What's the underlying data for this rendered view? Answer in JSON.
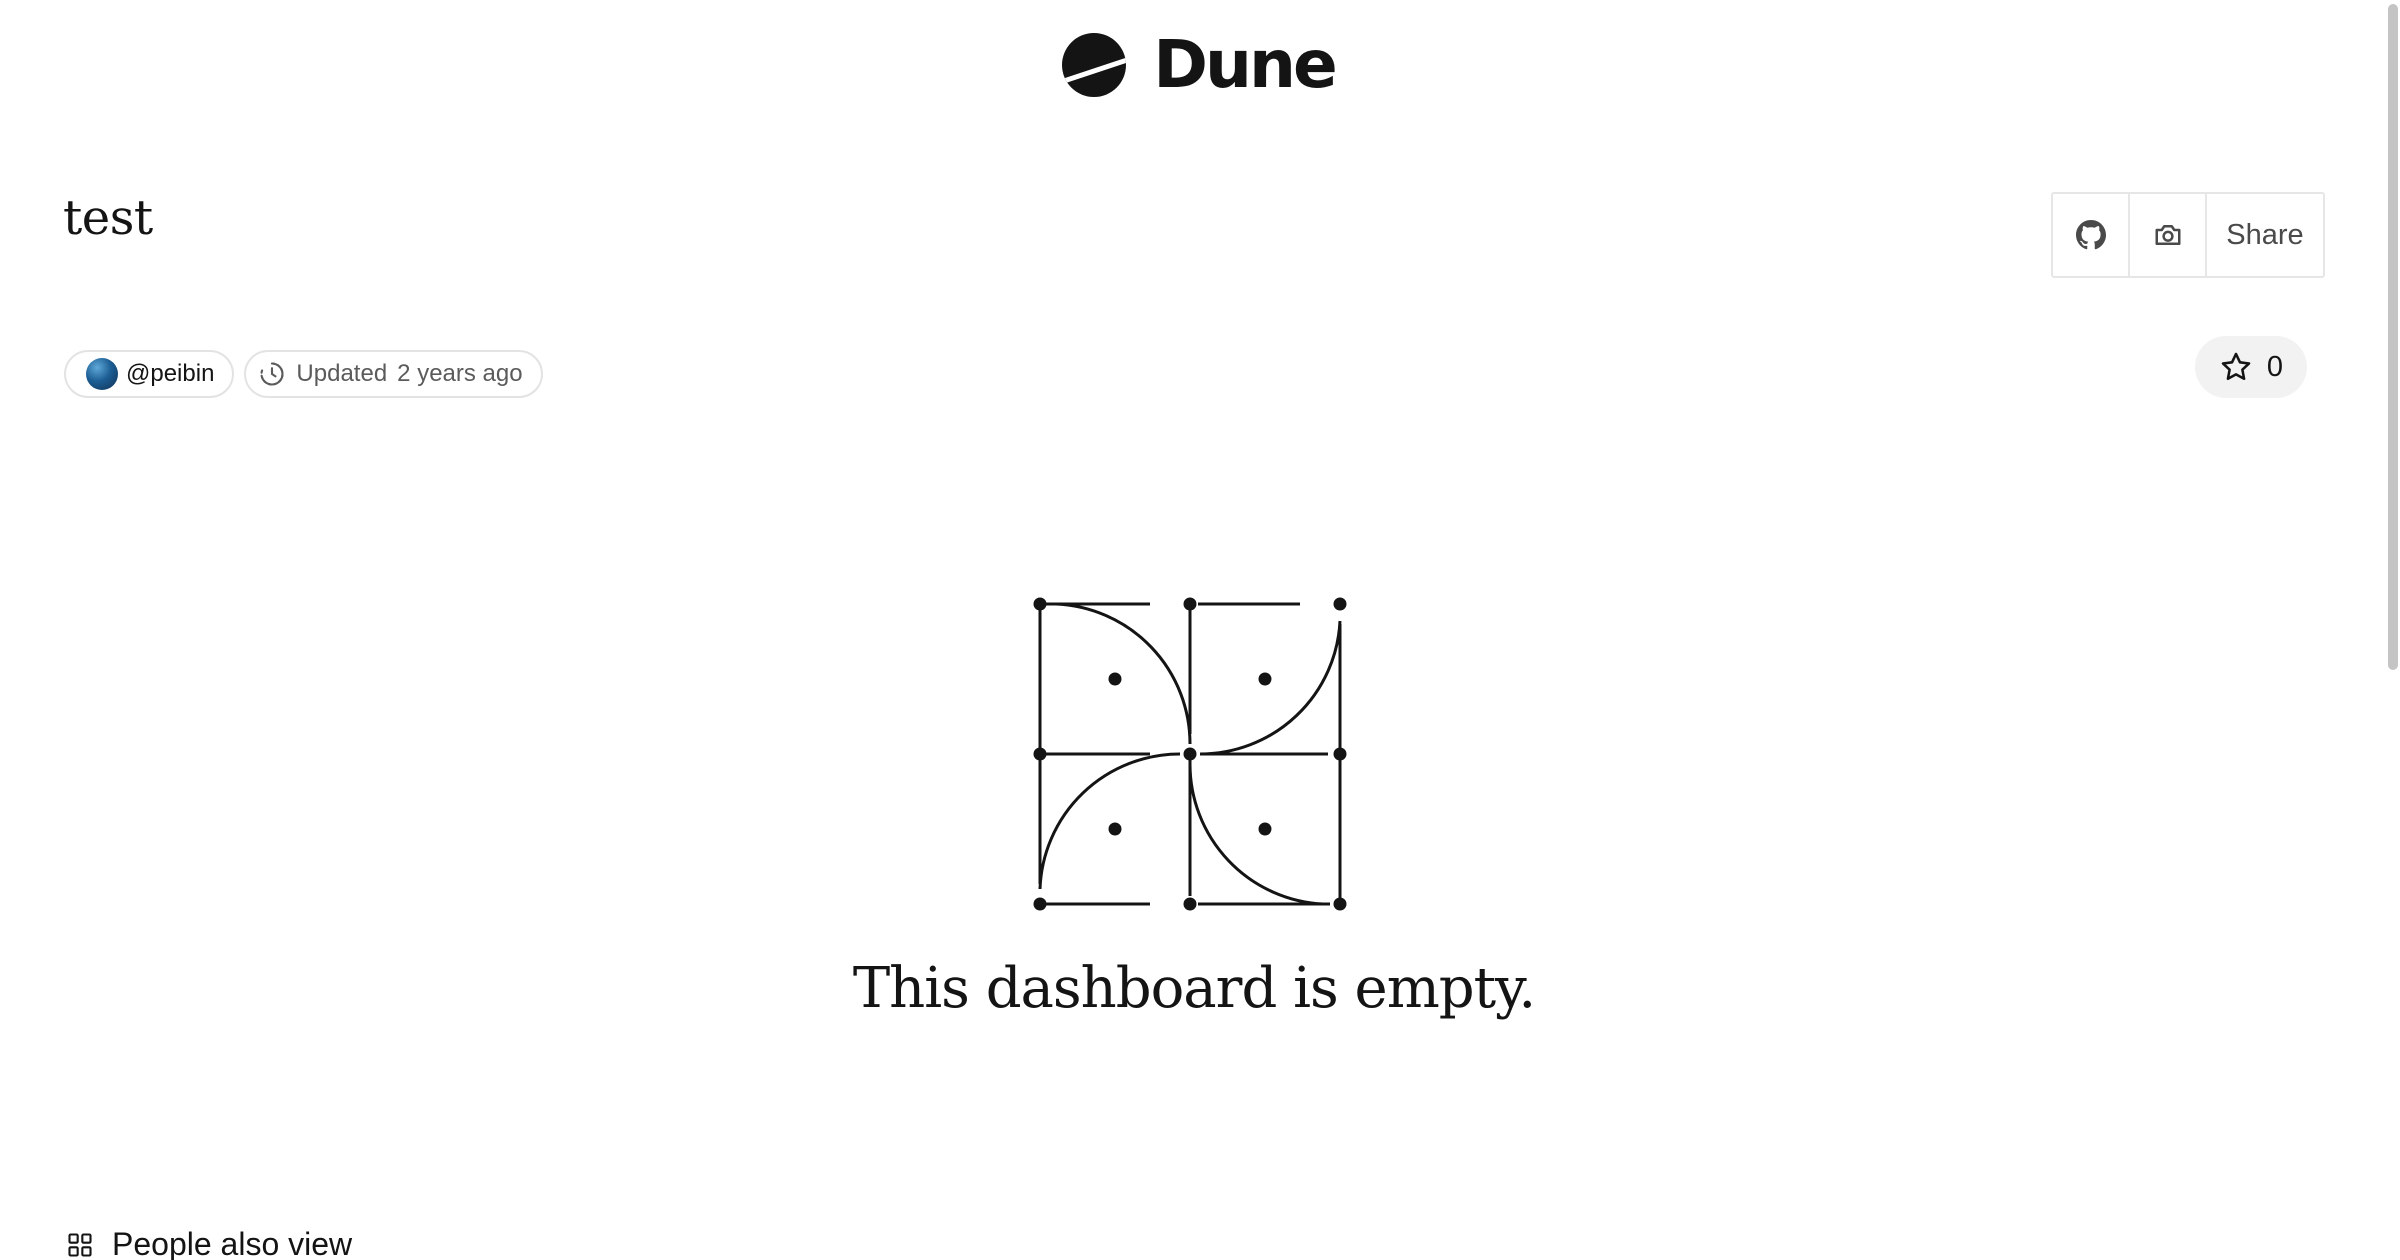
{
  "brand": {
    "name": "Dune"
  },
  "dashboard": {
    "title": "test",
    "author": "@peibin",
    "updated_label": "Updated",
    "updated_time": "2 years ago",
    "stars": "0"
  },
  "toolbar": {
    "share_label": "Share"
  },
  "empty_state": {
    "message": "This dashboard is empty."
  },
  "sections": {
    "people_also_view": "People also view"
  },
  "icons": {
    "logo": "dune-logo-icon",
    "github": "github-icon",
    "camera": "camera-icon",
    "clock": "clock-icon",
    "star": "star-icon",
    "grid": "grid-icon"
  }
}
